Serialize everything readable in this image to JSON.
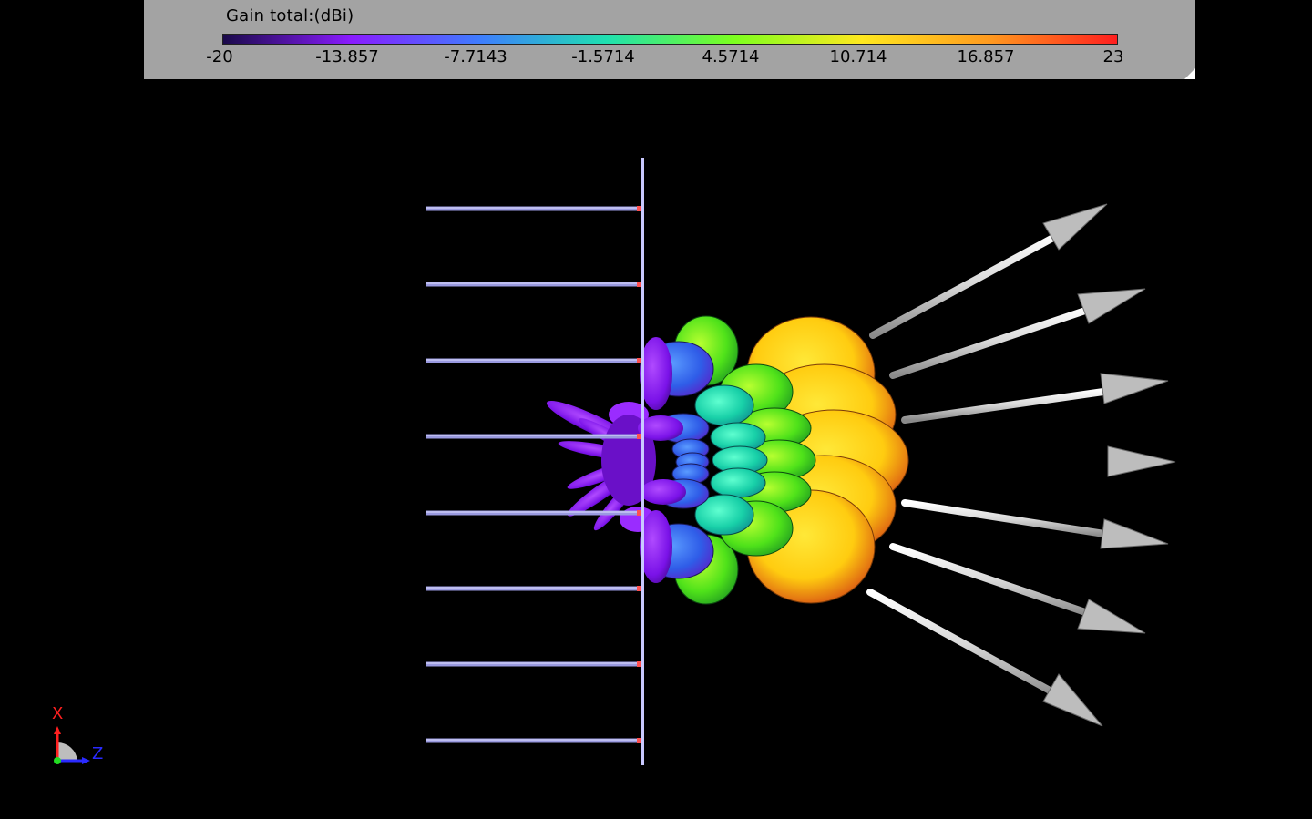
{
  "legend": {
    "title": "Gain total:(dBi)",
    "ticks": [
      "-20",
      "-13.857",
      "-7.7143",
      "-1.5714",
      "4.5714",
      "10.714",
      "16.857",
      "23"
    ],
    "colormap": [
      "#1a0a4a",
      "#8a1bff",
      "#3f7cff",
      "#1fe0b0",
      "#7cff1f",
      "#ffe81f",
      "#ff9a1f",
      "#ff1f1f"
    ]
  },
  "scene": {
    "element_count": 8,
    "beam_count": 7,
    "colors": {
      "element": "#8a8ad0",
      "ground_plane": "#b9b9ff",
      "arrow": "#e4e4e4",
      "sidelobe": "#7a12e8"
    }
  },
  "axes_triad": {
    "x_label": "X",
    "z_label": "Z",
    "x_color": "#ff2020",
    "z_color": "#2a2aff",
    "origin_color": "#22dd22"
  }
}
